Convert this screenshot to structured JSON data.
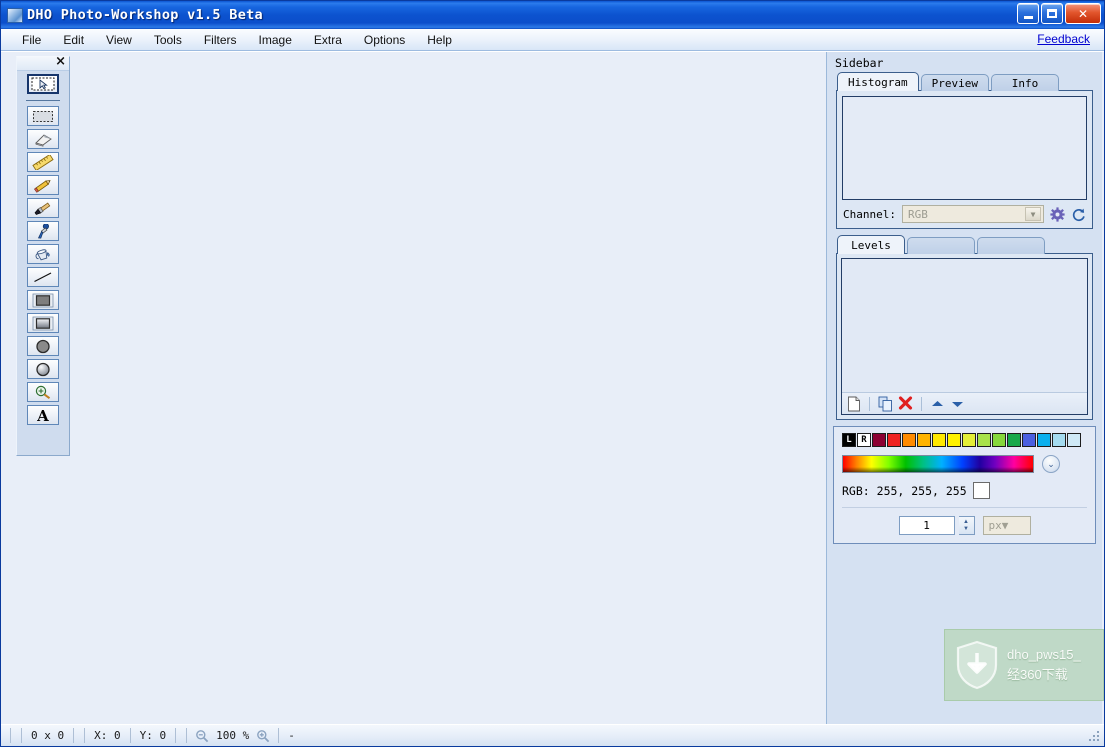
{
  "window": {
    "title": "DHO Photo-Workshop v1.5 Beta",
    "app_icon": "app-image-icon",
    "minimize_label": "Minimize",
    "maximize_label": "Maximize",
    "close_label": "Close"
  },
  "menubar": {
    "items": [
      {
        "label": "File"
      },
      {
        "label": "Edit"
      },
      {
        "label": "View"
      },
      {
        "label": "Tools"
      },
      {
        "label": "Filters"
      },
      {
        "label": "Image"
      },
      {
        "label": "Extra"
      },
      {
        "label": "Options"
      },
      {
        "label": "Help"
      }
    ],
    "feedback_label": "Feedback"
  },
  "toolbox": {
    "close_label": "×",
    "tools": [
      {
        "name": "move-select-tool",
        "icon": "pointer-arrow-icon",
        "selected": true
      },
      {
        "name": "marquee-select-tool",
        "icon": "rectangular-marquee-icon",
        "selected": false
      },
      {
        "name": "eraser-tool",
        "icon": "eraser-icon",
        "selected": false
      },
      {
        "name": "measure-tool",
        "icon": "ruler-icon",
        "selected": false
      },
      {
        "name": "pencil-tool",
        "icon": "pencil-icon",
        "selected": false
      },
      {
        "name": "brush-tool",
        "icon": "paintbrush-icon",
        "selected": false
      },
      {
        "name": "eyedropper-tool",
        "icon": "eyedropper-icon",
        "selected": false
      },
      {
        "name": "paint-bucket-tool",
        "icon": "paint-bucket-icon",
        "selected": false
      },
      {
        "name": "line-tool",
        "icon": "line-icon",
        "selected": false
      },
      {
        "name": "rectangle-tool",
        "icon": "filled-rectangle-icon",
        "selected": false
      },
      {
        "name": "gradient-rect-tool",
        "icon": "gradient-rectangle-icon",
        "selected": false
      },
      {
        "name": "ellipse-tool",
        "icon": "filled-circle-icon",
        "selected": false
      },
      {
        "name": "gradient-ellipse-tool",
        "icon": "gradient-circle-icon",
        "selected": false
      },
      {
        "name": "zoom-tool",
        "icon": "magnifier-plus-icon",
        "selected": false
      },
      {
        "name": "text-tool",
        "icon": "text-a-icon",
        "selected": false
      }
    ]
  },
  "sidebar": {
    "title": "Sidebar",
    "histogram_panel": {
      "tabs": [
        {
          "label": "Histogram",
          "active": true
        },
        {
          "label": "Preview",
          "active": false
        },
        {
          "label": "Info",
          "active": false
        }
      ],
      "channel_label": "Channel:",
      "channel_value": "RGB",
      "channel_disabled": true,
      "settings_icon": "gear-icon",
      "refresh_icon": "refresh-icon"
    },
    "levels_panel": {
      "tabs": [
        {
          "label": "Levels",
          "active": true
        },
        {
          "label": "",
          "active": false
        },
        {
          "label": "",
          "active": false
        }
      ],
      "toolbar": [
        {
          "name": "new-layer-button",
          "icon": "new-page-icon",
          "label": "New"
        },
        {
          "name": "duplicate-layer-button",
          "icon": "duplicate-icon",
          "label": "Duplicate"
        },
        {
          "name": "delete-layer-button",
          "icon": "delete-x-icon",
          "label": "Delete"
        },
        {
          "name": "move-up-button",
          "icon": "triangle-up-icon",
          "label": "Move Up"
        },
        {
          "name": "move-down-button",
          "icon": "triangle-down-icon",
          "label": "Move Down"
        }
      ]
    },
    "color_panel": {
      "left_swatch_label": "L",
      "right_swatch_label": "R",
      "left_swatch_color": "#000000",
      "right_swatch_color": "#ffffff",
      "swatches": [
        "#8c0033",
        "#ee2222",
        "#ff8a00",
        "#ffb300",
        "#ffe800",
        "#fff200",
        "#e4ef37",
        "#a8e24a",
        "#86d83c",
        "#17a84a",
        "#4a5fe0",
        "#0bb0ee",
        "#a4dbef",
        "#cfe9f6"
      ],
      "gradient_icon": "hue-gradient-strip",
      "expand_icon": "chevron-double-down-icon",
      "rgb_label": "RGB:",
      "rgb_value": "255, 255, 255",
      "current_color": "#ffffff",
      "size_value": "1",
      "size_unit": "px",
      "size_unit_disabled": true
    }
  },
  "statusbar": {
    "dimensions": "0 x 0",
    "x_coord": "X: 0",
    "y_coord": "Y: 0",
    "zoom_out_icon": "magnifier-minus-icon",
    "zoom_level": "100 %",
    "zoom_in_icon": "magnifier-plus-icon",
    "message": "-"
  },
  "download_overlay": {
    "icon": "shield-download-icon",
    "line1": "dho_pws15_",
    "line2": "经360下载"
  }
}
